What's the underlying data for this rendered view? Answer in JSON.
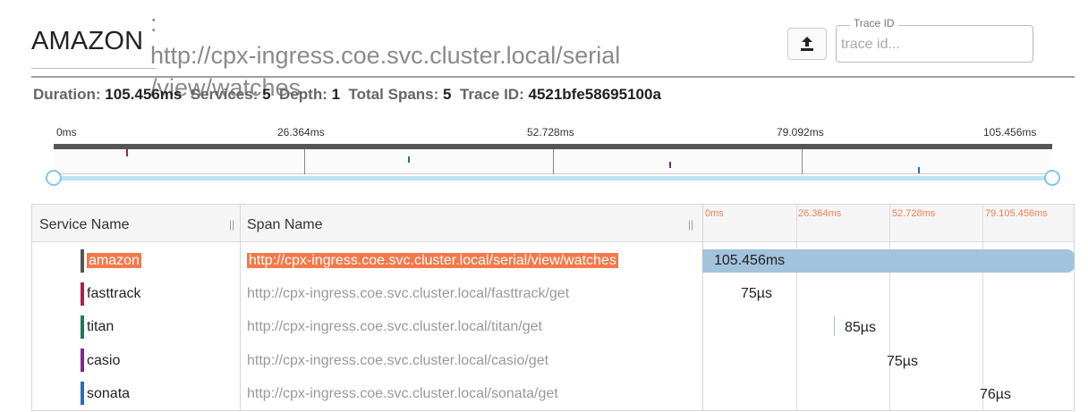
{
  "header": {
    "app_title": "AMAZON",
    "trace_name": ": http://cpx-ingress.coe.svc.cluster.local/serial /view/watches"
  },
  "trace_id_field": {
    "legend": "Trace ID",
    "placeholder": "trace id...",
    "value": ""
  },
  "upload": {
    "icon": "upload-icon"
  },
  "summary": {
    "duration_label": "Duration:",
    "duration": "105.456ms",
    "services_label": "Services:",
    "services": "5",
    "depth_label": "Depth:",
    "depth": "1",
    "total_spans_label": "Total Spans:",
    "total_spans": "5",
    "trace_id_label": "Trace ID:",
    "trace_id": "4521bfe58695100a"
  },
  "minimap": {
    "ticks": [
      "0ms",
      "26.364ms",
      "52.728ms",
      "79.092ms",
      "105.456ms"
    ]
  },
  "table": {
    "headers": {
      "service": "Service Name",
      "span": "Span Name",
      "grip": "||"
    },
    "timeline_ticks": [
      "0ms",
      "26.364ms",
      "52.728ms",
      "79.105.456ms"
    ],
    "rows": [
      {
        "service": "amazon",
        "span": "http://cpx-ingress.coe.svc.cluster.local/serial/view/watches",
        "duration": "105.456ms",
        "color": "#555555",
        "selected": true
      },
      {
        "service": "fasttrack",
        "span": "http://cpx-ingress.coe.svc.cluster.local/fasttrack/get",
        "duration": "75µs",
        "color": "#a3234d"
      },
      {
        "service": "titan",
        "span": "http://cpx-ingress.coe.svc.cluster.local/titan/get",
        "duration": "85µs",
        "color": "#1f7a5c"
      },
      {
        "service": "casio",
        "span": "http://cpx-ingress.coe.svc.cluster.local/casio/get",
        "duration": "75µs",
        "color": "#7b2a8c"
      },
      {
        "service": "sonata",
        "span": "http://cpx-ingress.coe.svc.cluster.local/sonata/get",
        "duration": "76µs",
        "color": "#2a6fb0"
      }
    ]
  },
  "colors": {
    "highlight": "#f4784a",
    "bar": "#a3c2db",
    "range": "#7ec8ec"
  }
}
